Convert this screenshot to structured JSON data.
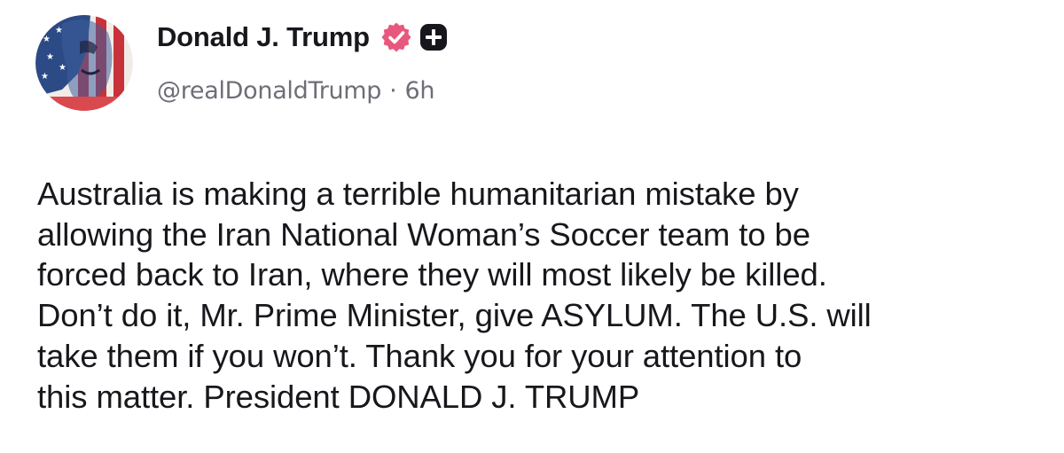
{
  "author": {
    "display_name": "Donald J. Trump",
    "handle": "@realDonaldTrump",
    "separator": "·",
    "timestamp": "6h",
    "verified_icon": "verified-badge-icon",
    "plus_icon": "plus-badge-icon",
    "avatar": "profile-avatar"
  },
  "post": {
    "text": "Australia is making a terrible humanitarian mistake by\nallowing the Iran National Woman’s Soccer team to be\nforced back to Iran, where they will most likely be killed.\nDon’t do it, Mr. Prime Minister, give ASYLUM. The U.S. will\ntake them if you won’t. Thank you for your attention to\nthis matter. President DONALD J. TRUMP"
  },
  "colors": {
    "text": "#17171c",
    "secondary": "#6e6e78",
    "verified_pink": "#e8577d",
    "background": "#ffffff"
  }
}
